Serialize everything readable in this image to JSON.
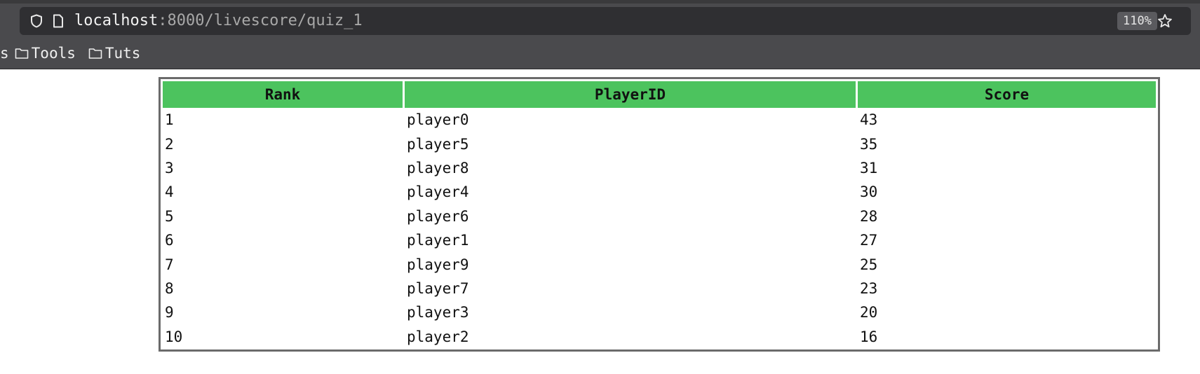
{
  "browser": {
    "url_host": "localhost",
    "url_rest": ":8000/livescore/quiz_1",
    "zoom": "110%",
    "bookmarks": [
      {
        "label": "s",
        "has_folder_icon": false
      },
      {
        "label": "Tools",
        "has_folder_icon": true
      },
      {
        "label": "Tuts",
        "has_folder_icon": true
      }
    ],
    "icons": {
      "tracking_protection": "shield-icon",
      "page_info": "page-icon",
      "bookmark_star": "star-icon",
      "folder": "folder-icon"
    }
  },
  "leaderboard": {
    "columns": [
      "Rank",
      "PlayerID",
      "Score"
    ],
    "rows": [
      {
        "rank": "1",
        "player": "player0",
        "score": "43"
      },
      {
        "rank": "2",
        "player": "player5",
        "score": "35"
      },
      {
        "rank": "3",
        "player": "player8",
        "score": "31"
      },
      {
        "rank": "4",
        "player": "player4",
        "score": "30"
      },
      {
        "rank": "5",
        "player": "player6",
        "score": "28"
      },
      {
        "rank": "6",
        "player": "player1",
        "score": "27"
      },
      {
        "rank": "7",
        "player": "player9",
        "score": "25"
      },
      {
        "rank": "8",
        "player": "player7",
        "score": "23"
      },
      {
        "rank": "9",
        "player": "player3",
        "score": "20"
      },
      {
        "rank": "10",
        "player": "player2",
        "score": "16"
      }
    ],
    "header_color": "#4cc35e",
    "border_color": "#6b6b6b"
  }
}
